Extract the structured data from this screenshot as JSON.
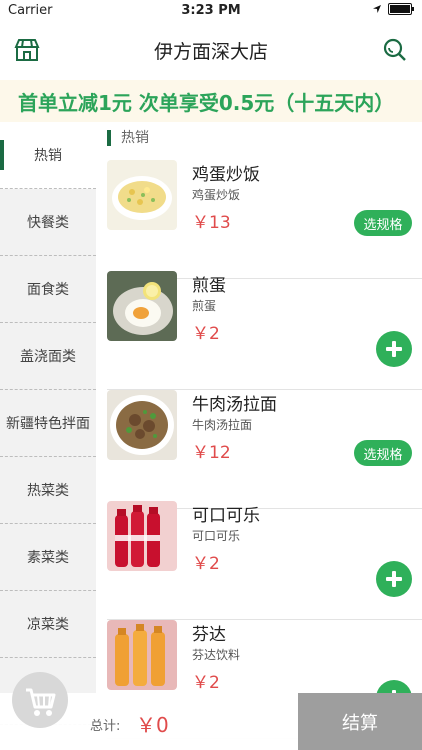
{
  "status_bar": {
    "carrier": "Carrier",
    "time": "3:23 PM"
  },
  "nav": {
    "title": "伊方面深大店",
    "left_icon": "store-icon",
    "right_icon": "search-icon"
  },
  "promo": {
    "text": "首单立减1元 次单享受0.5元（十五天内）"
  },
  "sidebar": {
    "categories": [
      {
        "label": "热销",
        "active": true
      },
      {
        "label": "快餐类"
      },
      {
        "label": "面食类"
      },
      {
        "label": "盖浇面类"
      },
      {
        "label": "新疆特色拌面"
      },
      {
        "label": "热菜类"
      },
      {
        "label": "素菜类"
      },
      {
        "label": "凉菜类"
      },
      {
        "label": ""
      }
    ]
  },
  "section": {
    "title": "热销"
  },
  "items": [
    {
      "name": "鸡蛋炒饭",
      "desc": "鸡蛋炒饭",
      "price": "￥13",
      "action": "选规格",
      "image_icon": "fried-rice-photo"
    },
    {
      "name": "煎蛋",
      "desc": "煎蛋",
      "price": "￥2",
      "action_icon": "plus-icon",
      "image_icon": "fried-egg-photo"
    },
    {
      "name": "牛肉汤拉面",
      "desc": "牛肉汤拉面",
      "price": "￥12",
      "action": "选规格",
      "image_icon": "noodle-soup-photo"
    },
    {
      "name": "可口可乐",
      "desc": "可口可乐",
      "price": "￥2",
      "action_icon": "plus-icon",
      "image_icon": "cola-photo"
    },
    {
      "name": "芬达",
      "desc": "芬达饮料",
      "price": "￥2",
      "action_icon": "plus-icon",
      "image_icon": "fanta-photo"
    }
  ],
  "cart": {
    "total_label": "总计:",
    "total_value": "￥0",
    "checkout": "结算",
    "icon": "cart-icon"
  },
  "colors": {
    "accent": "#2fb05a",
    "dark_green": "#1b6b43",
    "price": "#e04b4b",
    "promo_bg": "#fdf8ea",
    "sidebar_bg": "#f2f2f2",
    "checkout_bg": "#9e9e9e"
  }
}
